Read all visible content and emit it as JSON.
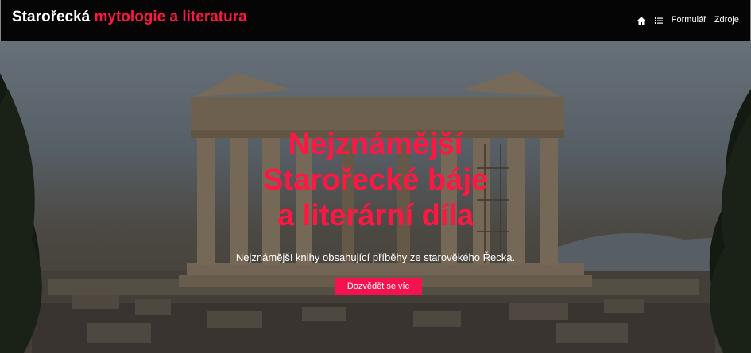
{
  "navbar": {
    "brand_main": "Starořecká",
    "brand_accent": "mytologie a literatura",
    "home_icon": "home-icon",
    "list_icon": "list-icon",
    "links": [
      "Formulář",
      "Zdroje"
    ]
  },
  "hero": {
    "headline_lines": [
      "Nejznámější",
      "Starořecké báje",
      "a literární díla"
    ],
    "subtitle": "Nejznámější knihy obsahující příběhy ze starověkého Řecka.",
    "cta_label": "Dozvědět se víc",
    "background": "parthenon-photo"
  },
  "colors": {
    "accent": "#ff1744",
    "button": "#f5134f",
    "navbar": "#050505"
  }
}
